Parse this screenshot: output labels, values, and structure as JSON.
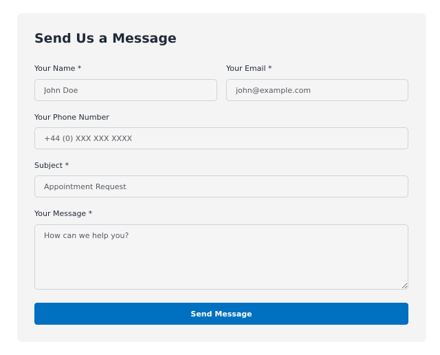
{
  "form": {
    "title": "Send Us a Message",
    "name": {
      "label": "Your Name *",
      "placeholder": "John Doe",
      "value": ""
    },
    "email": {
      "label": "Your Email *",
      "placeholder": "john@example.com",
      "value": ""
    },
    "phone": {
      "label": "Your Phone Number",
      "placeholder": "+44 (0) XXX XXX XXXX",
      "value": ""
    },
    "subject": {
      "label": "Subject *",
      "placeholder": "Appointment Request",
      "value": ""
    },
    "message": {
      "label": "Your Message *",
      "placeholder": "How can we help you?",
      "value": ""
    },
    "submit_label": "Send Message"
  },
  "colors": {
    "card_background": "#f4f4f5",
    "field_border": "#cfd3d8",
    "primary_button": "#0070c0",
    "button_text": "#ffffff"
  }
}
